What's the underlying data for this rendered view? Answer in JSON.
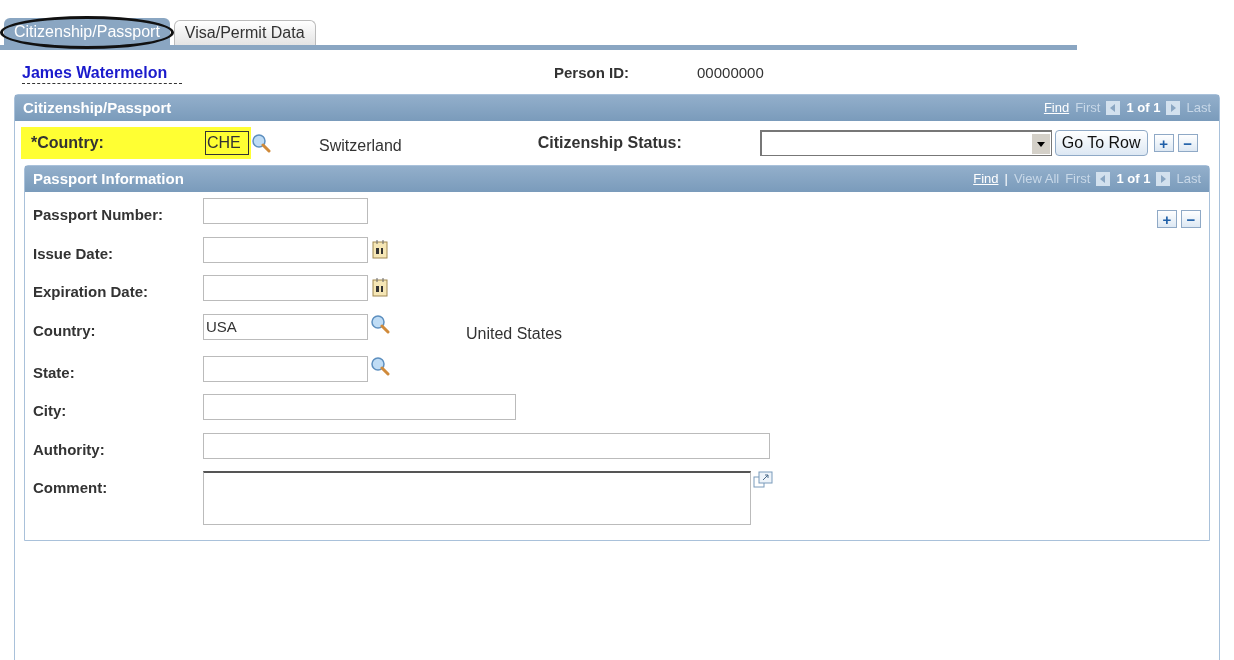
{
  "tabs": [
    {
      "label": "Citizenship/Passport",
      "selected": true,
      "circled": true
    },
    {
      "label": "Visa/Permit Data",
      "selected": false,
      "circled": false
    }
  ],
  "person": {
    "name": "James Watermelon",
    "id_label": "Person ID:",
    "id_value": "00000000"
  },
  "citizenship": {
    "title": "Citizenship/Passport",
    "nav": {
      "find": "Find",
      "first": "First",
      "count": "1 of 1",
      "last": "Last"
    },
    "country_label": "*Country:",
    "country_value": "CHE",
    "country_name": "Switzerland",
    "status_label": "Citizenship Status:",
    "go_to_row": "Go To Row",
    "add": "+",
    "remove": "−"
  },
  "passport": {
    "title": "Passport Information",
    "nav": {
      "find": "Find",
      "separator": "|",
      "view_all": "View All",
      "first": "First",
      "count": "1 of 1",
      "last": "Last"
    },
    "add": "+",
    "remove": "−",
    "fields": [
      {
        "label": "Passport Number:",
        "kind": "text"
      },
      {
        "label": "Issue Date:",
        "kind": "date"
      },
      {
        "label": "Expiration Date:",
        "kind": "date"
      },
      {
        "label": "Country:",
        "kind": "lookup",
        "value": "USA",
        "description": "United States"
      },
      {
        "label": "State:",
        "kind": "lookup"
      },
      {
        "label": "City:",
        "kind": "text"
      },
      {
        "label": "Authority:",
        "kind": "text"
      },
      {
        "label": "Comment:",
        "kind": "textarea"
      }
    ]
  }
}
